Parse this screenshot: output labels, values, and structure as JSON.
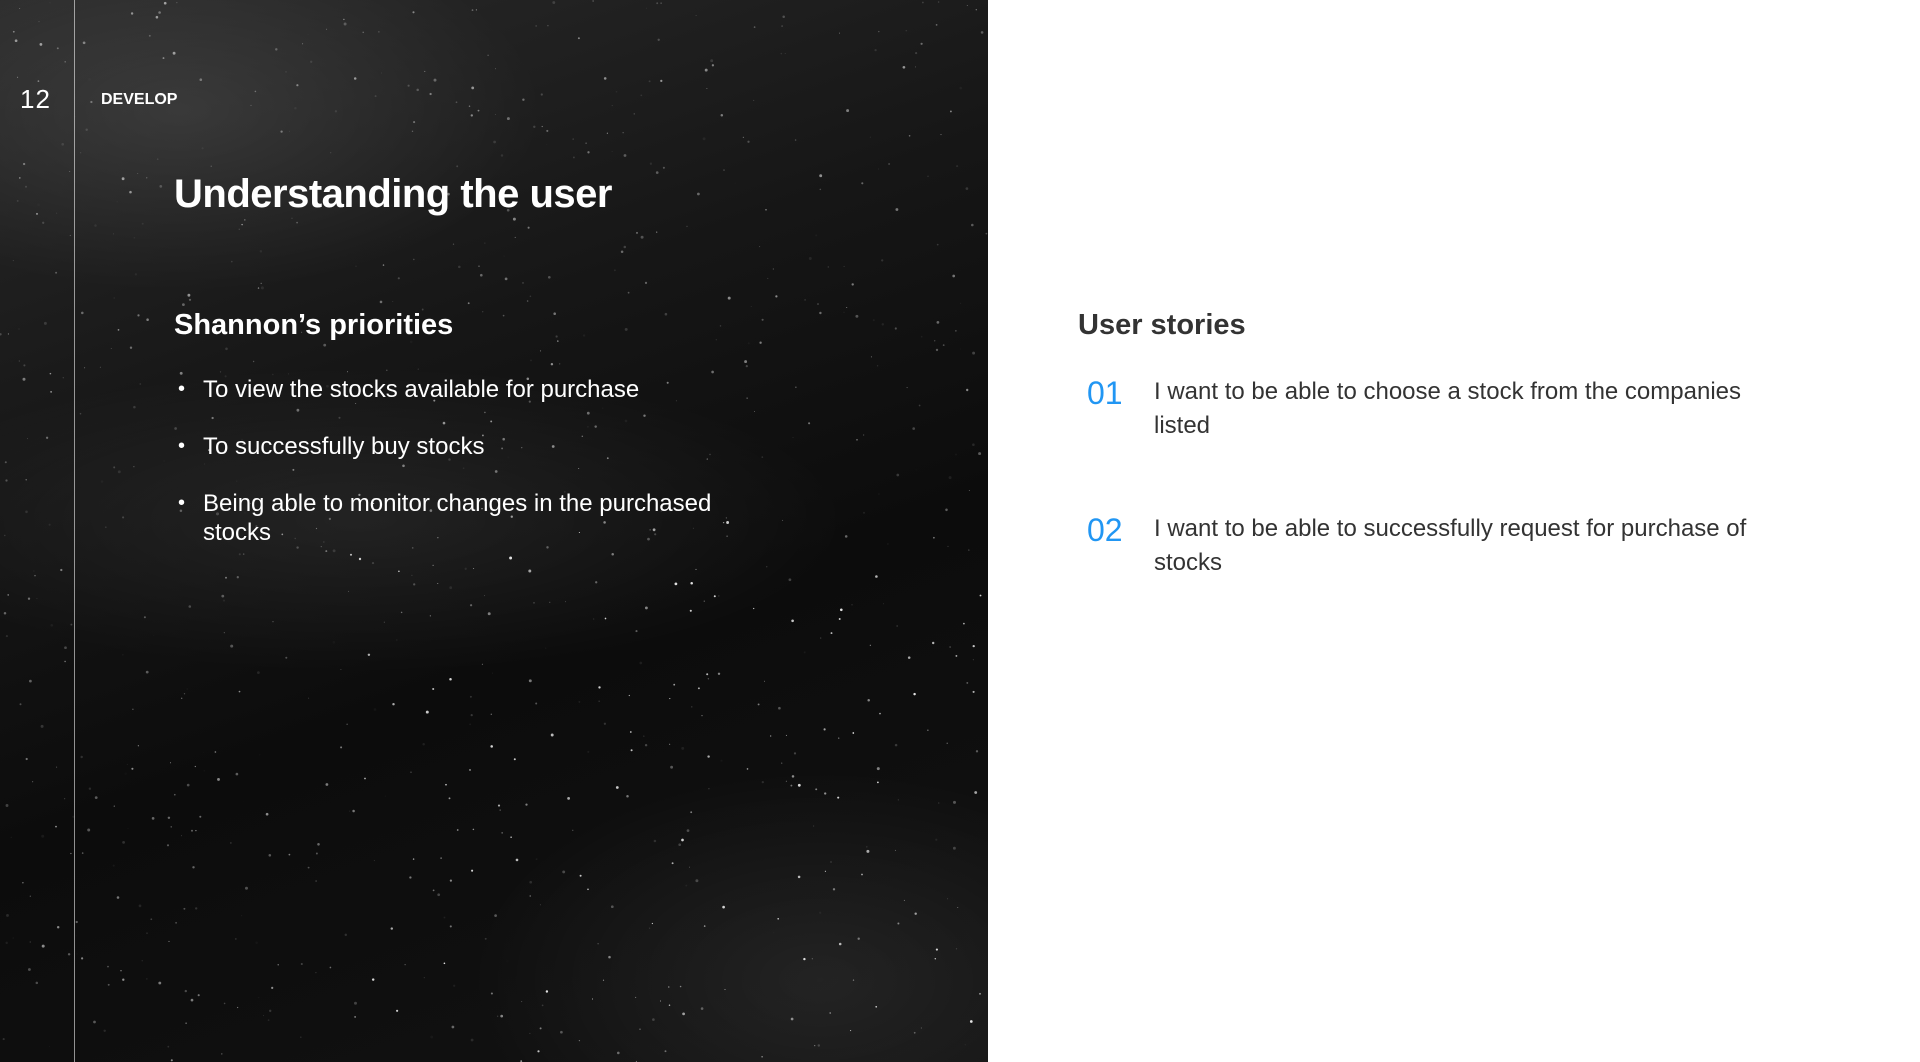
{
  "slide": {
    "page_number": "12",
    "section": "DEVELOP",
    "title": "Understanding the user"
  },
  "priorities": {
    "heading": "Shannon’s priorities",
    "items": [
      "To view the stocks available for purchase",
      "To successfully buy stocks",
      "Being able to monitor changes in the purchased stocks"
    ]
  },
  "user_stories": {
    "heading": "User stories",
    "items": [
      {
        "number": "01",
        "text": "I want to be able to choose a stock from the companies listed"
      },
      {
        "number": "02",
        "text": "I want to be able to successfully request for purchase of stocks"
      }
    ]
  },
  "colors": {
    "accent": "#2196f3",
    "dark_panel": "#111111",
    "body_text": "#333333"
  }
}
